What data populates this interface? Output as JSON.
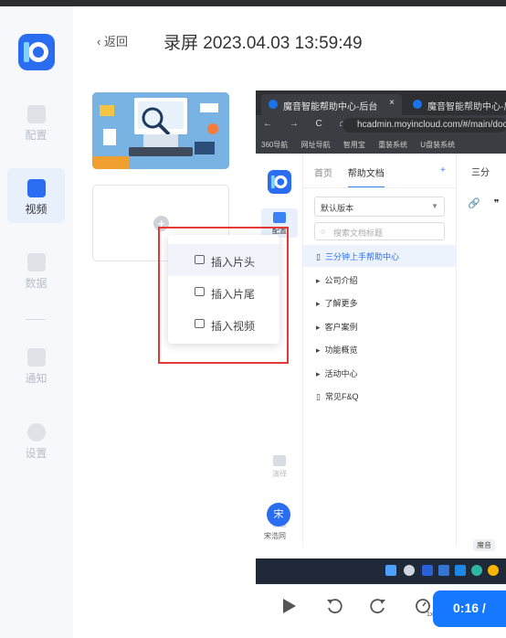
{
  "nav": {
    "items": [
      {
        "label": "配置",
        "icon": "settings-page-icon"
      },
      {
        "label": "视频",
        "icon": "video-icon"
      },
      {
        "label": "数据",
        "icon": "chart-icon"
      },
      {
        "label": "通知",
        "icon": "notification-icon"
      },
      {
        "label": "设置",
        "icon": "gear-icon"
      }
    ],
    "active": "视频"
  },
  "header": {
    "back_label": "返回",
    "title": "录屏 2023.04.03 13:59:49"
  },
  "insert_menu": {
    "items": [
      "插入片头",
      "插入片尾",
      "插入视频"
    ]
  },
  "preview": {
    "browser": {
      "tab1": "魔音智能帮助中心-后台",
      "tab2": "魔音智能帮助中心-后台",
      "url": "hcadmin.moyincloud.com/#/main/doc",
      "bookmarks": [
        "360导航",
        "网址导航",
        "智用宝",
        "重装系统",
        "U盘装系统"
      ]
    },
    "sidebar": {
      "items": [
        "配置",
        "演绎",
        "设置"
      ],
      "avatar_initial": "宋",
      "avatar_name": "宋浩同"
    },
    "tree": {
      "tabs": [
        "首页",
        "帮助文档"
      ],
      "add": "+",
      "version": "默认版本",
      "search_placeholder": "搜索文档标题",
      "items": [
        {
          "label": "三分钟上手帮助中心",
          "type": "doc",
          "selected": true
        },
        {
          "label": "公司介绍",
          "type": "folder"
        },
        {
          "label": "了解更多",
          "type": "folder"
        },
        {
          "label": "客户案例",
          "type": "folder"
        },
        {
          "label": "功能概览",
          "type": "folder"
        },
        {
          "label": "活动中心",
          "type": "folder"
        },
        {
          "label": "常见F&Q",
          "type": "doc"
        }
      ]
    },
    "content": {
      "heading": "三分",
      "icons": "🔗 ❞",
      "bottom_tag": "魔音"
    }
  },
  "player": {
    "time": "0:16 /"
  },
  "colors": {
    "accent": "#1677ff",
    "highlight_border": "#e53935",
    "nav_active_bg": "#e8f0fc"
  }
}
